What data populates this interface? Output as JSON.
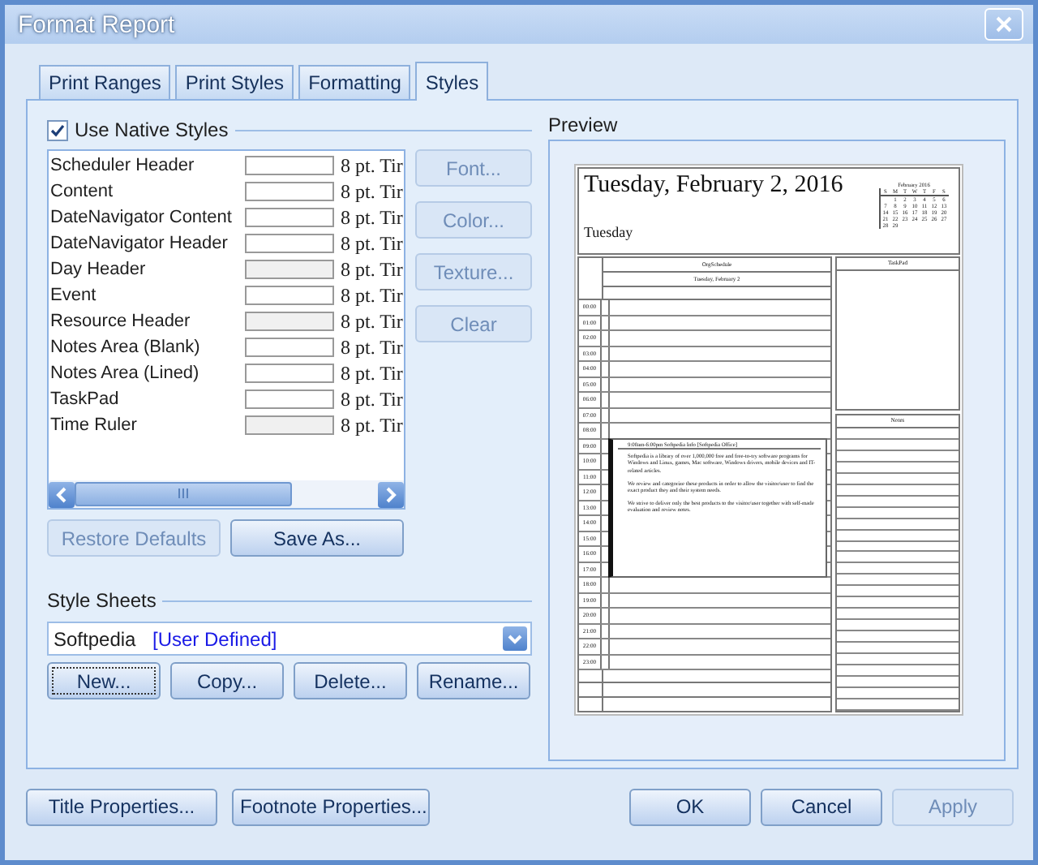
{
  "window": {
    "title": "Format Report"
  },
  "tabs": [
    {
      "label": "Print Ranges",
      "selected": false
    },
    {
      "label": "Print Styles",
      "selected": false
    },
    {
      "label": "Formatting",
      "selected": false
    },
    {
      "label": "Styles",
      "selected": true
    }
  ],
  "native_styles": {
    "label": "Use Native Styles",
    "checked": true
  },
  "styles": [
    {
      "name": "Scheduler Header",
      "color": "#ffffff",
      "font": "8 pt. Tir"
    },
    {
      "name": "Content",
      "color": "#ffffff",
      "font": "8 pt. Tir"
    },
    {
      "name": "DateNavigator Content",
      "color": "#ffffff",
      "font": "8 pt. Tir"
    },
    {
      "name": "DateNavigator Header",
      "color": "#ffffff",
      "font": "8 pt. Tir"
    },
    {
      "name": "Day Header",
      "color": "#f0f0f0",
      "font": "8 pt. Tir"
    },
    {
      "name": "Event",
      "color": "#ffffff",
      "font": "8 pt. Tir"
    },
    {
      "name": "Resource Header",
      "color": "#f0f0f0",
      "font": "8 pt. Tir"
    },
    {
      "name": "Notes Area (Blank)",
      "color": "#ffffff",
      "font": "8 pt. Tir"
    },
    {
      "name": "Notes Area (Lined)",
      "color": "#ffffff",
      "font": "8 pt. Tir"
    },
    {
      "name": "TaskPad",
      "color": "#ffffff",
      "font": "8 pt. Tir"
    },
    {
      "name": "Time Ruler",
      "color": "#f0f0f0",
      "font": "8 pt. Tir"
    }
  ],
  "style_buttons": [
    {
      "label": "Font...",
      "disabled": true
    },
    {
      "label": "Color...",
      "disabled": true
    },
    {
      "label": "Texture...",
      "disabled": true
    },
    {
      "label": "Clear",
      "disabled": true
    }
  ],
  "list_buttons": [
    {
      "label": "Restore Defaults",
      "disabled": true
    },
    {
      "label": "Save As...",
      "disabled": false
    }
  ],
  "style_sheets": {
    "title": "Style Sheets",
    "name": "Softpedia",
    "note": "[User Defined]"
  },
  "sheet_buttons": [
    {
      "label": "New...",
      "focused": true
    },
    {
      "label": "Copy...",
      "focused": false
    },
    {
      "label": "Delete...",
      "focused": false
    },
    {
      "label": "Rename...",
      "focused": false
    }
  ],
  "preview": {
    "title": "Preview",
    "page": {
      "date_title": "Tuesday, February 2, 2016",
      "day": "Tuesday",
      "calendar": {
        "month": "February 2016",
        "weekdays": [
          "S",
          "M",
          "T",
          "W",
          "T",
          "F",
          "S"
        ],
        "weeks": [
          [
            "1",
            "2",
            "3",
            "4",
            "5",
            "6"
          ],
          [
            "7",
            "8",
            "9",
            "10",
            "11",
            "12",
            "13"
          ],
          [
            "14",
            "15",
            "16",
            "17",
            "18",
            "19",
            "20"
          ],
          [
            "21",
            "22",
            "23",
            "24",
            "25",
            "26",
            "27"
          ],
          [
            "28",
            "29"
          ]
        ]
      },
      "resource": "OrgSchedule",
      "date_header": "Tuesday, February 2",
      "times": [
        "00:00",
        "01:00",
        "02:00",
        "03:00",
        "04:00",
        "05:00",
        "06:00",
        "07:00",
        "08:00",
        "09:00",
        "10:00",
        "11:00",
        "12:00",
        "13:00",
        "14:00",
        "15:00",
        "16:00",
        "17:00",
        "18:00",
        "19:00",
        "20:00",
        "21:00",
        "22:00",
        "23:00"
      ],
      "event": {
        "time": "9:00am-6:00pm Softpedia Info [Softpedia Office]",
        "paragraphs": [
          "Softpedia is a library of over 1,000,000 free and free-to-try software programs for Windows and Linux, games, Mac software, Windows drivers, mobile devices and IT-related articles.",
          "We review and categorize these products in order to allow the visitor/user to find the exact product they and their system needs.",
          "We strive to deliver only the best products to the visitor/user together with self-made evaluation and review notes."
        ]
      },
      "taskpad": "TaskPad",
      "notes": "Notes"
    }
  },
  "footer_buttons": [
    {
      "label": "Title Properties...",
      "disabled": false
    },
    {
      "label": "Footnote Properties...",
      "disabled": false
    }
  ],
  "dialog_buttons": [
    {
      "label": "OK",
      "disabled": false
    },
    {
      "label": "Cancel",
      "disabled": false
    },
    {
      "label": "Apply",
      "disabled": true
    }
  ]
}
